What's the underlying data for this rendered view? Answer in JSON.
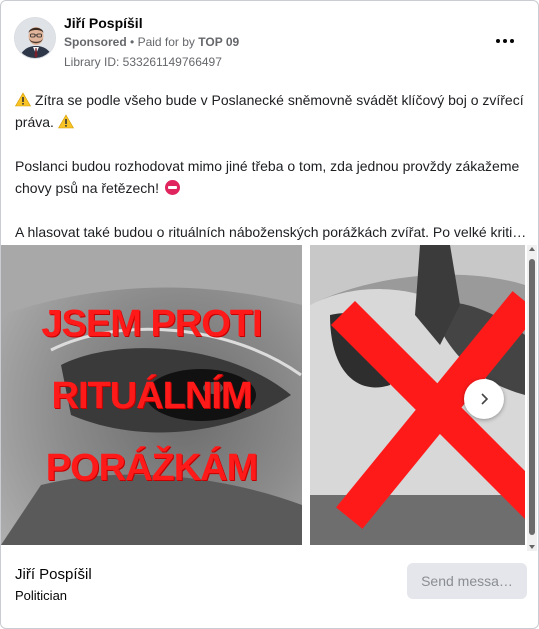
{
  "header": {
    "author_name": "Jiří Pospíšil",
    "sponsored": "Sponsored",
    "separator": "•",
    "paid_for_prefix": "Paid for by",
    "paid_for_by": "TOP 09",
    "library_id": "Library ID: 533261149766497",
    "more_icon": "more-dots-icon"
  },
  "post": {
    "p1_text": "Zítra se podle všeho bude v Poslanecké sněmovně svádět klíčový boj o zvířecí práva.",
    "p2_text": "Poslanci budou rozhodovat mimo jiné třeba o tom, zda jednou provždy zákažeme chovy psů na řetězech!",
    "p3_text": "A hlasovat také budou o rituálních náboženských porážkách zvířat. Po velké kritic…",
    "warning_icon": "warning-icon",
    "noentry_icon": "no-entry-icon"
  },
  "carousel": {
    "slide1_lines": [
      "JSEM PROTI",
      "RITUÁLNÍM",
      "PORÁŽKÁM"
    ],
    "next_icon": "chevron-right-icon"
  },
  "footer": {
    "name": "Jiří Pospíšil",
    "role": "Politician",
    "send_button": "Send messa…"
  },
  "colors": {
    "accent_red": "#ff1a1a",
    "meta_gray": "#65676b",
    "button_bg": "#e4e6eb"
  }
}
